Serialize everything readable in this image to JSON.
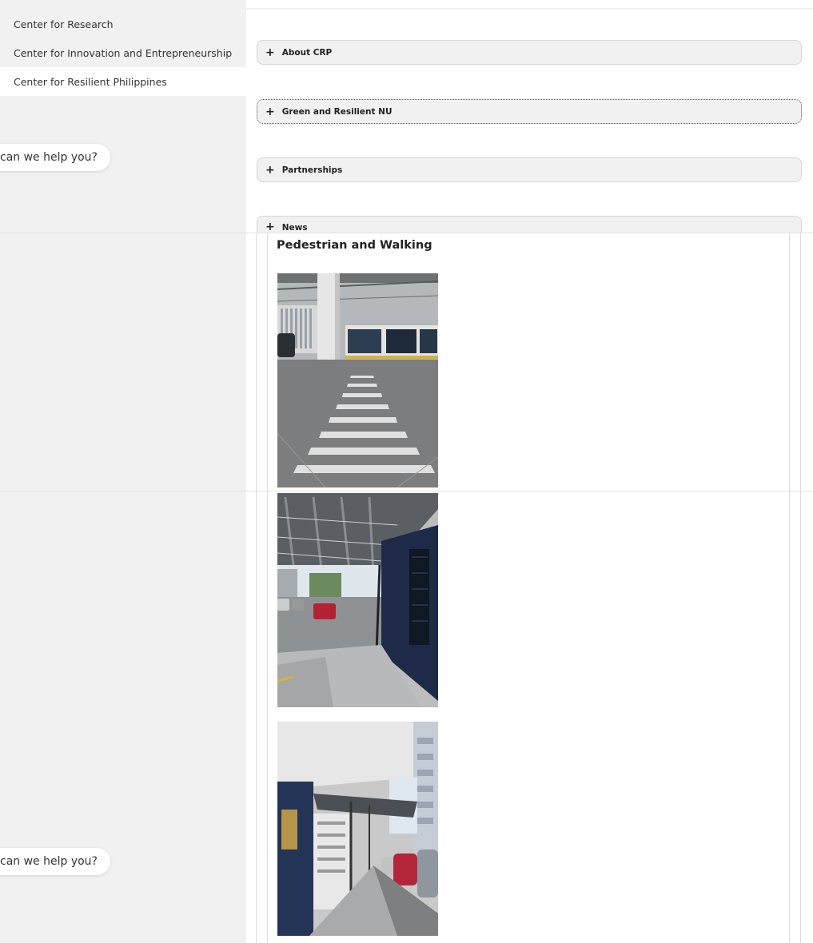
{
  "sidebar": {
    "items": [
      {
        "label": "Center for Research"
      },
      {
        "label": "Center for Innovation and Entrepreneurship"
      },
      {
        "label": "Center for Resilient Philippines"
      }
    ],
    "chat_bubbles": [
      "can we help you?",
      "can we help you?"
    ]
  },
  "accordion": [
    {
      "label": "About CRP",
      "icon": "plus-icon"
    },
    {
      "label": "Green and Resilient NU",
      "icon": "plus-icon"
    },
    {
      "label": "Partnerships",
      "icon": "plus-icon"
    },
    {
      "label": "News",
      "icon": "plus-icon"
    }
  ],
  "content": {
    "section_title": "Pedestrian and Walking"
  }
}
